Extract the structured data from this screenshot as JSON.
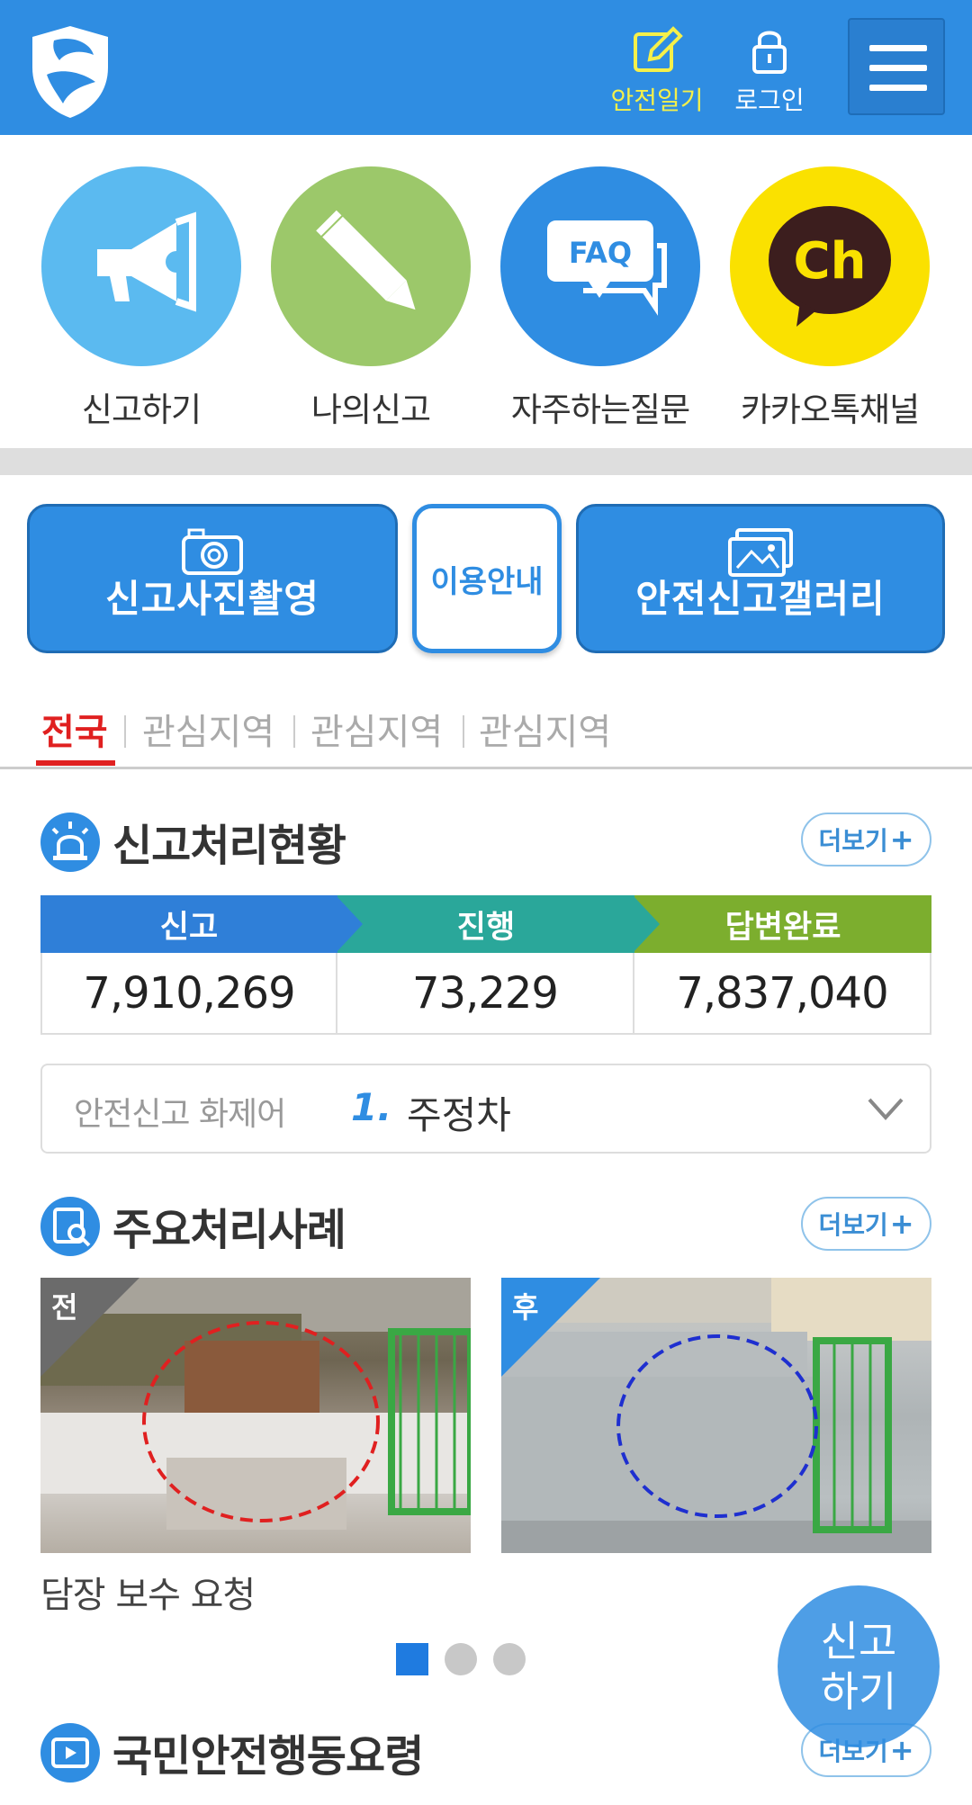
{
  "header": {
    "diary_label": "안전일기",
    "login_label": "로그인"
  },
  "quick_menu": [
    {
      "label": "신고하기",
      "icon": "megaphone-icon"
    },
    {
      "label": "나의신고",
      "icon": "pencil-icon"
    },
    {
      "label": "자주하는질문",
      "icon": "faq-icon",
      "badge": "FAQ"
    },
    {
      "label": "카카오톡채널",
      "icon": "kakao-channel-icon",
      "badge": "Ch"
    }
  ],
  "actions": {
    "photo_label": "신고사진촬영",
    "guide_label": "이용안내",
    "gallery_label": "안전신고갤러리"
  },
  "region_tabs": [
    "전국",
    "관심지역",
    "관심지역",
    "관심지역"
  ],
  "status_section": {
    "title": "신고처리현황",
    "more_label": "더보기",
    "columns": [
      "신고",
      "진행",
      "답변완료"
    ],
    "values": [
      "7,910,269",
      "73,229",
      "7,837,040"
    ]
  },
  "keyword": {
    "label": "안전신고 화제어",
    "rank": "1.",
    "term": "주정차"
  },
  "cases_section": {
    "title": "주요처리사례",
    "more_label": "더보기",
    "before_label": "전",
    "after_label": "후",
    "case_title": "담장 보수 요청"
  },
  "pager": {
    "count": 3,
    "active": 0
  },
  "fab_label": "신고\n하기",
  "action_section": {
    "title": "국민안전행동요령",
    "more_label": "더보기"
  },
  "colors": {
    "primary": "#2f8de2",
    "report": "#2f7fd8",
    "progress": "#2aa79a",
    "done": "#7cae2e",
    "active_tab": "#e02020",
    "kakao": "#fae100"
  }
}
